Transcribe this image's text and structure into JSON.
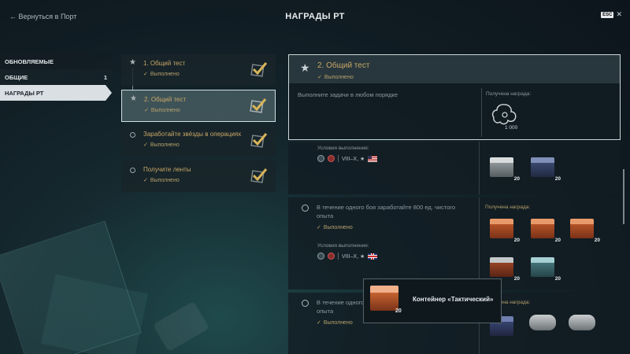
{
  "header": {
    "back_label": "← Вернуться в Порт",
    "title": "НАГРАДЫ РТ",
    "esc_label": "ESC"
  },
  "sidebar": {
    "items": [
      {
        "label": "ОБНОВЛЯЕМЫЕ",
        "count": ""
      },
      {
        "label": "ОБЩИЕ",
        "count": "1"
      },
      {
        "label": "НАГРАДЫ РТ",
        "count": ""
      }
    ]
  },
  "tasks": [
    {
      "title": "1. Общий тест",
      "status": "Выполнено"
    },
    {
      "title": "2. Общий тест",
      "status": "Выполнено"
    },
    {
      "title": "Заработайте звёзды в операциях",
      "status": "Выполнено"
    },
    {
      "title": "Получите ленты",
      "status": "Выполнено"
    }
  ],
  "detail": {
    "title": "2. Общий тест",
    "status": "Выполнено",
    "description": "Выполните задачи в любом порядке",
    "reward_label": "Получена награда:",
    "reward_count": "1 000"
  },
  "objectives": [
    {
      "condition_label": "Условия выполнения:",
      "tiers": "VIII–X, ★",
      "flag": "us",
      "rewards": [
        {
          "kind": "silver",
          "count": "20"
        },
        {
          "kind": "navy",
          "count": "20"
        }
      ]
    },
    {
      "text_line1": "В течение одного боя заработайте 800 ед. чистого",
      "text_line2": "опыта",
      "status": "Выполнено",
      "condition_label": "Условия выполнения:",
      "tiers": "VIII–X, ★",
      "flag": "uk",
      "reward_label": "Получена награда:",
      "rewards": [
        {
          "kind": "orange",
          "count": "20"
        },
        {
          "kind": "orange",
          "count": "20"
        },
        {
          "kind": "orange",
          "count": "20"
        },
        {
          "kind": "red",
          "count": "20"
        },
        {
          "kind": "teal",
          "count": "20"
        }
      ]
    },
    {
      "text_line1": "В течение одного",
      "text_line2": "опыта",
      "status": "Выполнено",
      "reward_label": "Получена награда:"
    }
  ],
  "tooltip": {
    "title": "Контейнер «Тактический»",
    "count": "20"
  },
  "colors": {
    "accent_gold": "#c8a766",
    "background": "#101b22",
    "active_border": "#cfe0e2"
  }
}
